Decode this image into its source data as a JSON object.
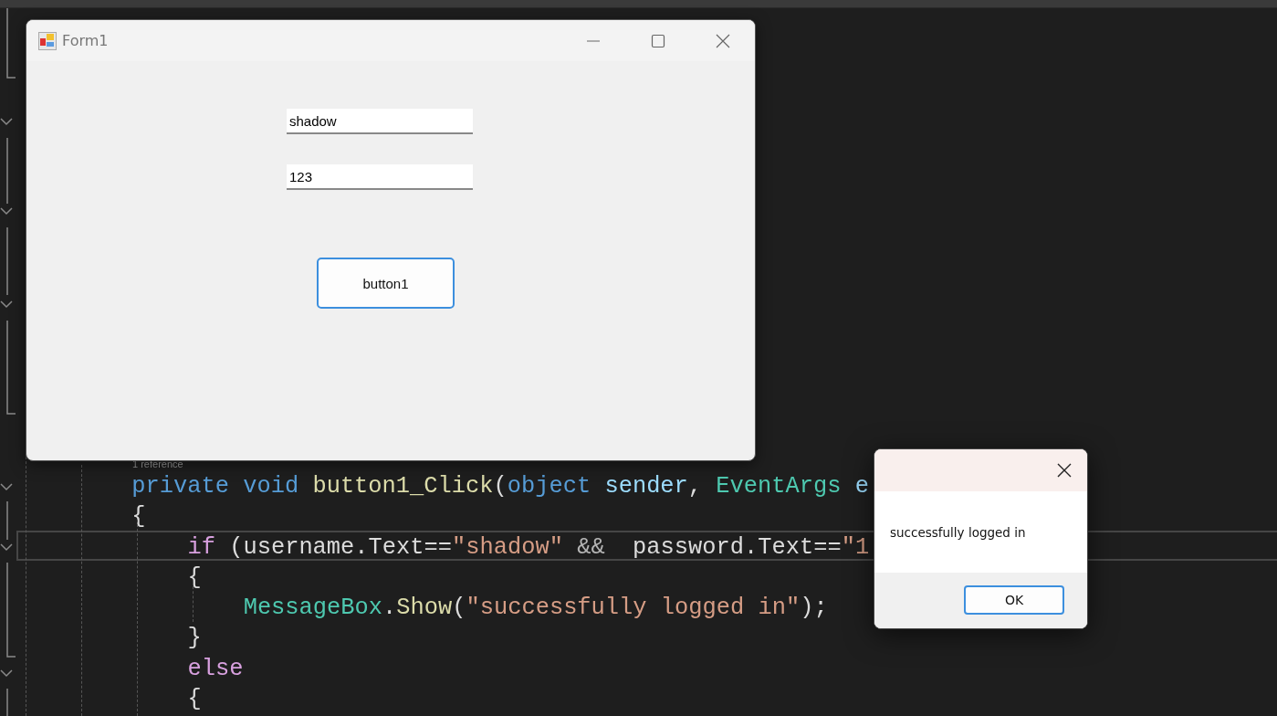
{
  "editor": {
    "codelens": "1 reference",
    "lines": [
      {
        "kind": "member",
        "current": false,
        "tokens": [
          {
            "text": "private ",
            "kind": "keyword"
          },
          {
            "text": "void ",
            "kind": "keyword"
          },
          {
            "text": "button1_Click",
            "kind": "method"
          },
          {
            "text": "(",
            "kind": "plain"
          },
          {
            "text": "object ",
            "kind": "keyword"
          },
          {
            "text": "sender",
            "kind": "param"
          },
          {
            "text": ", ",
            "kind": "plain"
          },
          {
            "text": "EventArgs ",
            "kind": "type"
          },
          {
            "text": "e",
            "kind": "param"
          }
        ]
      },
      {
        "kind": "member",
        "current": false,
        "tokens": [
          {
            "text": "{",
            "kind": "plain"
          }
        ]
      },
      {
        "kind": "body",
        "current": true,
        "tokens": [
          {
            "text": "if ",
            "kind": "control"
          },
          {
            "text": "(username.Text==",
            "kind": "plain"
          },
          {
            "text": "\"shadow\" ",
            "kind": "string"
          },
          {
            "text": "&&",
            "kind": "operator"
          },
          {
            "text": "  password.Text==",
            "kind": "plain"
          },
          {
            "text": "\"1",
            "kind": "string"
          }
        ]
      },
      {
        "kind": "body",
        "current": false,
        "tokens": [
          {
            "text": "{",
            "kind": "plain"
          }
        ]
      },
      {
        "kind": "nested",
        "current": false,
        "tokens": [
          {
            "text": "MessageBox",
            "kind": "type"
          },
          {
            "text": ".",
            "kind": "plain"
          },
          {
            "text": "Show",
            "kind": "method"
          },
          {
            "text": "(",
            "kind": "plain"
          },
          {
            "text": "\"successfully logged in\"",
            "kind": "string"
          },
          {
            "text": ");",
            "kind": "plain"
          }
        ]
      },
      {
        "kind": "body",
        "current": false,
        "tokens": [
          {
            "text": "}",
            "kind": "plain"
          }
        ]
      },
      {
        "kind": "body",
        "current": false,
        "tokens": [
          {
            "text": "else",
            "kind": "control"
          }
        ]
      },
      {
        "kind": "body",
        "current": false,
        "tokens": [
          {
            "text": "{",
            "kind": "plain"
          }
        ]
      }
    ]
  },
  "form": {
    "title": "Form1",
    "username": "shadow",
    "password": "123",
    "button": "button1"
  },
  "message_box": {
    "message": "successfully logged in",
    "button": "OK"
  }
}
